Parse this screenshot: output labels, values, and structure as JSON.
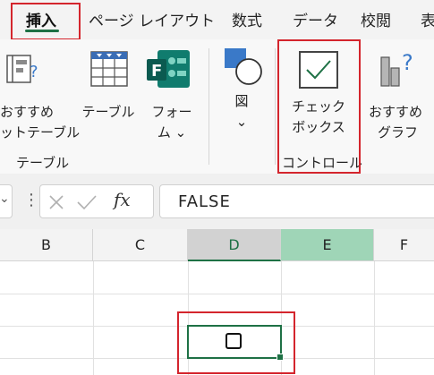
{
  "tabs": [
    {
      "label": "挿入",
      "active": true
    },
    {
      "label": "ページ レイアウト"
    },
    {
      "label": "数式"
    },
    {
      "label": "データ"
    },
    {
      "label": "校閲"
    },
    {
      "label": "表"
    }
  ],
  "ribbon": {
    "recommended_pivot": {
      "line1": "おすすめ",
      "line2": "ットテーブル",
      "icon": "recommended-pivottable-icon"
    },
    "table": {
      "label": "テーブル",
      "icon": "table-icon"
    },
    "forms": {
      "line1": "フォー",
      "line2": "ム ⌄",
      "icon": "forms-icon"
    },
    "illustrations": {
      "line1": "図",
      "line2": "⌄",
      "icon": "shapes-icon"
    },
    "checkbox": {
      "line1": "チェック",
      "line2": "ボックス",
      "icon": "checkbox-icon"
    },
    "recommended_charts": {
      "line1": "おすすめ",
      "line2": "グラフ",
      "icon": "recommended-charts-icon"
    },
    "groups": {
      "tables": "テーブル",
      "controls": "コントロール"
    }
  },
  "formula_bar": {
    "fx": "fx",
    "value": "FALSE"
  },
  "columns": [
    "B",
    "C",
    "D",
    "E",
    "F"
  ],
  "colors": {
    "accent": "#1e7145",
    "highlight": "#d4252d",
    "selected_header": "#9fd5b7"
  },
  "cell": {
    "checkbox_checked": false
  }
}
